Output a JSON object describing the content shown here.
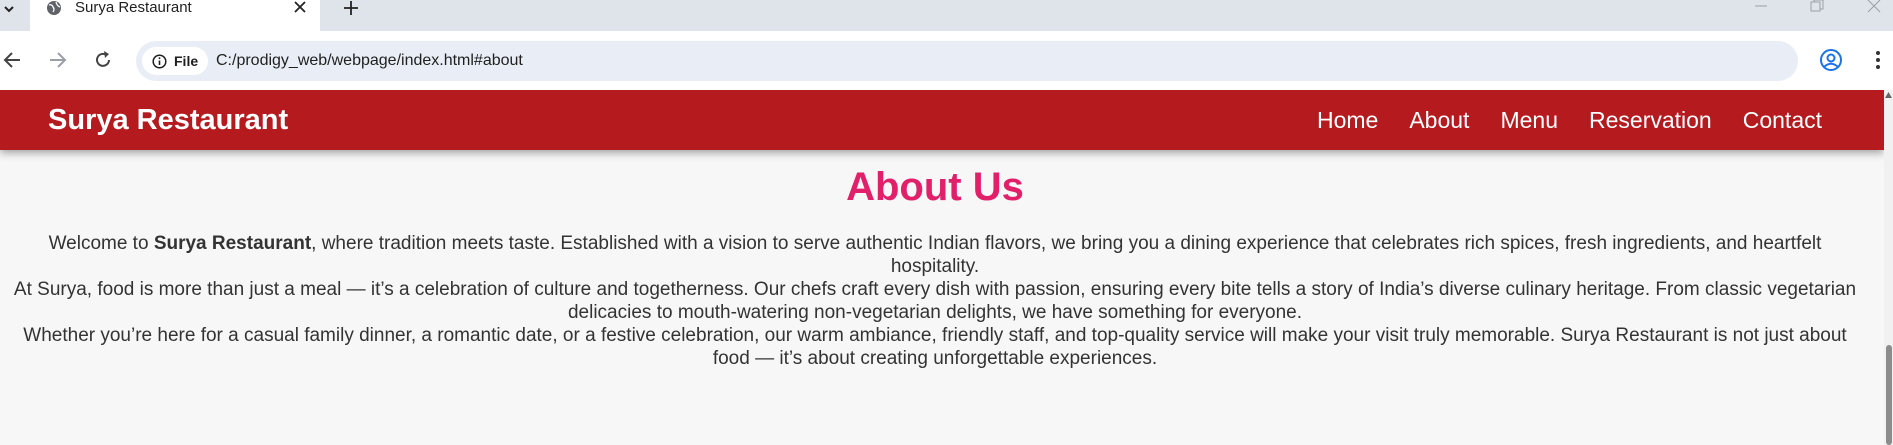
{
  "browser": {
    "tab_title": "Surya Restaurant",
    "new_tab_symbol": "+",
    "chip_label": "File",
    "url": "C:/prodigy_web/webpage/index.html#about",
    "icons": [
      "globe-icon",
      "close-icon",
      "plus-icon",
      "back-icon",
      "forward-icon",
      "reload-icon",
      "info-icon",
      "star-icon",
      "profile-icon",
      "menu-icon",
      "minimize-icon",
      "restore-icon"
    ]
  },
  "site": {
    "brand": "Surya Restaurant",
    "nav": [
      "Home",
      "About",
      "Menu",
      "Reservation",
      "Contact"
    ],
    "colors": {
      "header": "#b51b1e",
      "heading": "#e2206a",
      "body_text": "#333333",
      "background": "#f7f7f7"
    }
  },
  "about": {
    "heading": "About Us",
    "p1_before": "Welcome to ",
    "p1_bold": "Surya Restaurant",
    "p1_after": ", where tradition meets taste. Established with a vision to serve authentic Indian flavors, we bring you a dining experience that celebrates rich spices, fresh ingredients, and heartfelt hospitality.",
    "p2": "At Surya, food is more than just a meal — it’s a celebration of culture and togetherness. Our chefs craft every dish with passion, ensuring every bite tells a story of India’s diverse culinary heritage. From classic vegetarian delicacies to mouth-watering non-vegetarian delights, we have something for everyone.",
    "p3": "Whether you’re here for a casual family dinner, a romantic date, or a festive celebration, our warm ambiance, friendly staff, and top-quality service will make your visit truly memorable. Surya Restaurant is not just about food — it’s about creating unforgettable experiences."
  }
}
